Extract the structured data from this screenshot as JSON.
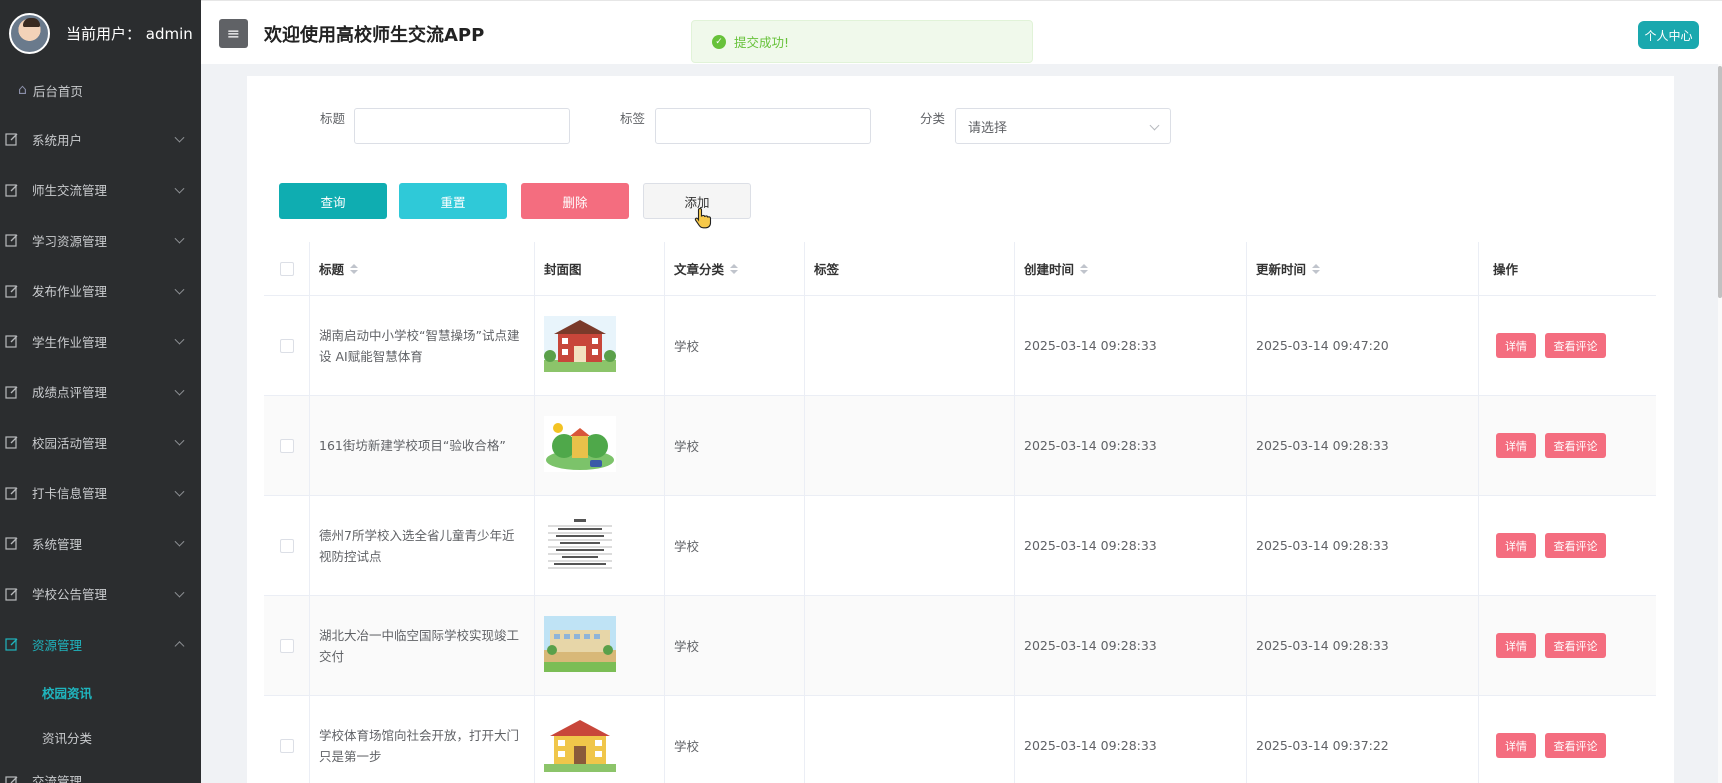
{
  "sidebar": {
    "user_text": "当前用户：  admin",
    "home": "后台首页",
    "menu": [
      {
        "label": "系统用户",
        "expanded": false
      },
      {
        "label": "师生交流管理",
        "expanded": false
      },
      {
        "label": "学习资源管理",
        "expanded": false
      },
      {
        "label": "发布作业管理",
        "expanded": false
      },
      {
        "label": "学生作业管理",
        "expanded": false
      },
      {
        "label": "成绩点评管理",
        "expanded": false
      },
      {
        "label": "校园活动管理",
        "expanded": false
      },
      {
        "label": "打卡信息管理",
        "expanded": false
      },
      {
        "label": "系统管理",
        "expanded": false
      },
      {
        "label": "学校公告管理",
        "expanded": false
      },
      {
        "label": "资源管理",
        "expanded": true
      }
    ],
    "submenu": [
      "校园资讯",
      "资讯分类"
    ],
    "partial_item": "交流管理"
  },
  "header": {
    "menu_toggle_icon": "hamburger-icon",
    "title": "欢迎使用高校师生交流APP",
    "toast": "提交成功!",
    "profile_button": "个人中心"
  },
  "filters": {
    "title_label": "标题",
    "tag_label": "标签",
    "category_label": "分类",
    "category_placeholder": "请选择"
  },
  "actions": {
    "query": "查询",
    "reset": "重置",
    "delete": "删除",
    "add": "添加"
  },
  "table": {
    "headers": {
      "title": "标题",
      "cover": "封面图",
      "category": "文章分类",
      "tags": "标签",
      "created": "创建时间",
      "updated": "更新时间",
      "ops": "操作"
    },
    "rows": [
      {
        "title": "湖南启动中小学校“智慧操场”试点建设 AI赋能智慧体育",
        "category": "学校",
        "tags": "",
        "created": "2025-03-14 09:28:33",
        "updated": "2025-03-14 09:47:20"
      },
      {
        "title": "161街坊新建学校项目“验收合格”",
        "category": "学校",
        "tags": "",
        "created": "2025-03-14 09:28:33",
        "updated": "2025-03-14 09:28:33"
      },
      {
        "title": "德州7所学校入选全省儿童青少年近视防控试点",
        "category": "学校",
        "tags": "",
        "created": "2025-03-14 09:28:33",
        "updated": "2025-03-14 09:28:33"
      },
      {
        "title": "湖北大冶一中临空国际学校实现竣工交付",
        "category": "学校",
        "tags": "",
        "created": "2025-03-14 09:28:33",
        "updated": "2025-03-14 09:28:33"
      },
      {
        "title": "学校体育场馆向社会开放，打开大门只是第一步",
        "category": "学校",
        "tags": "",
        "created": "2025-03-14 09:28:33",
        "updated": "2025-03-14 09:37:22"
      }
    ],
    "row_actions": {
      "detail": "详情",
      "comments": "查看评论"
    }
  },
  "colors": {
    "sidebar_bg": "#2b2d2f",
    "accent": "#1aa8ae",
    "danger_btn": "#f46d7f",
    "toast_green": "#67c23a"
  }
}
